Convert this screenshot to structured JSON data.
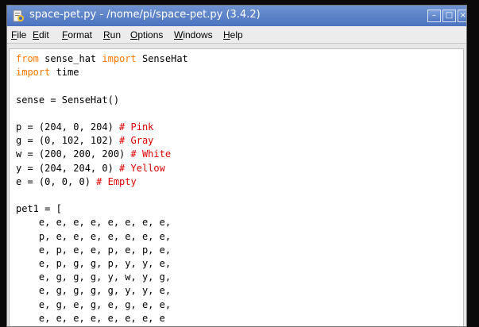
{
  "window": {
    "title": "space-pet.py - /nome/pi/space-pet.py (3.4.2)",
    "minimize_label": "–",
    "maximize_label": "□",
    "close_label": "×"
  },
  "menubar": {
    "items": [
      {
        "mnemonic": "F",
        "rest": "ile"
      },
      {
        "mnemonic": "E",
        "rest": "dit"
      },
      {
        "mnemonic": "F",
        "rest": "ormat"
      },
      {
        "mnemonic": "R",
        "rest": "un"
      },
      {
        "mnemonic": "O",
        "rest": "ptions"
      },
      {
        "mnemonic": "W",
        "rest": "indows"
      },
      {
        "mnemonic": "H",
        "rest": "elp"
      }
    ]
  },
  "editor": {
    "lines": [
      [
        {
          "t": "from",
          "c": "kw"
        },
        {
          "t": " sense_hat "
        },
        {
          "t": "import",
          "c": "kw"
        },
        {
          "t": " SenseHat"
        }
      ],
      [
        {
          "t": "import",
          "c": "kw"
        },
        {
          "t": " time"
        }
      ],
      [],
      [
        {
          "t": "sense = SenseHat()"
        }
      ],
      [],
      [
        {
          "t": "p = (204, 0, 204) "
        },
        {
          "t": "# Pink",
          "c": "cm"
        }
      ],
      [
        {
          "t": "g = (0, 102, 102) "
        },
        {
          "t": "# Gray",
          "c": "cm"
        }
      ],
      [
        {
          "t": "w = (200, 200, 200) "
        },
        {
          "t": "# White",
          "c": "cm"
        }
      ],
      [
        {
          "t": "y = (204, 204, 0) "
        },
        {
          "t": "# Yellow",
          "c": "cm"
        }
      ],
      [
        {
          "t": "e = (0, 0, 0) "
        },
        {
          "t": "# Empty",
          "c": "cm"
        }
      ],
      [],
      [
        {
          "t": "pet1 = ["
        }
      ],
      [
        {
          "t": "    e, e, e, e, e, e, e, e,"
        }
      ],
      [
        {
          "t": "    p, e, e, e, e, e, e, e,"
        }
      ],
      [
        {
          "t": "    e, p, e, e, p, e, p, e,"
        }
      ],
      [
        {
          "t": "    e, p, g, g, p, y, y, e,"
        }
      ],
      [
        {
          "t": "    e, g, g, g, y, w, y, g,"
        }
      ],
      [
        {
          "t": "    e, g, g, g, g, y, y, e,"
        }
      ],
      [
        {
          "t": "    e, g, e, g, e, g, e, e,"
        }
      ],
      [
        {
          "t": "    e, e, e, e, e, e, e, e"
        }
      ]
    ]
  },
  "colors": {
    "keyword": "#ff7700",
    "comment": "#dd0000",
    "titlebar": "#5a82c8"
  },
  "icons": {
    "app": "python-file-icon"
  }
}
